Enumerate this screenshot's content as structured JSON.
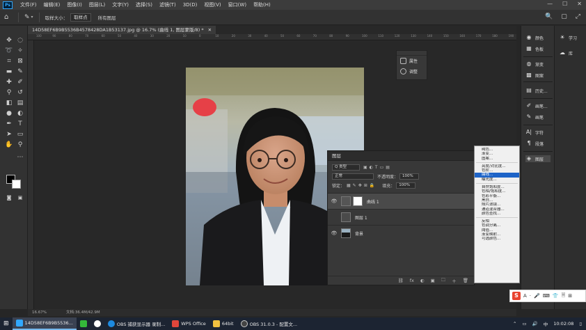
{
  "menubar": {
    "logo": "Ps",
    "items": [
      "文件(F)",
      "编辑(E)",
      "图像(I)",
      "图层(L)",
      "文字(Y)",
      "选择(S)",
      "滤镜(T)",
      "3D(D)",
      "视图(V)",
      "窗口(W)",
      "帮助(H)"
    ],
    "controls": [
      "—",
      "☐",
      "✕"
    ]
  },
  "optionsbar": {
    "sample_label": "取样大小：",
    "sample_value": "取样点",
    "sample2": "所有图层",
    "right_icons": [
      "🔍",
      "▢",
      "⤢"
    ]
  },
  "document": {
    "tab_title": "14D58EF6B9B5536B4578428DA1B53137.jpg @ 16.7% (曲线 1, 图层蒙版/8) *",
    "tab_close": "✕"
  },
  "ruler": {
    "ticks": [
      "100",
      "90",
      "80",
      "70",
      "60",
      "50",
      "40",
      "30",
      "20",
      "10",
      "0",
      "10",
      "20",
      "30",
      "40",
      "50",
      "60",
      "70",
      "80",
      "90",
      "100",
      "110",
      "120",
      "130",
      "140",
      "150",
      "160",
      "170",
      "180",
      "190"
    ]
  },
  "status": {
    "zoom": "16.67%",
    "doc": "文档:36.4M/42.9M"
  },
  "float_panel": {
    "items": [
      "属性",
      "调整"
    ]
  },
  "right_dock1": {
    "items": [
      {
        "label": "颜色",
        "icon": "palette-icon"
      },
      {
        "label": "色板",
        "icon": "swatches-icon"
      },
      {
        "label": "渐变",
        "icon": "gradient-icon"
      },
      {
        "label": "图案",
        "icon": "pattern-icon"
      },
      {
        "label": "历史...",
        "icon": "history-icon"
      },
      {
        "label": "画笔...",
        "icon": "brush-icon"
      },
      {
        "label": "画笔",
        "icon": "brush2-icon"
      },
      {
        "label": "字符",
        "icon": "char-icon"
      },
      {
        "label": "段落",
        "icon": "paragraph-icon"
      },
      {
        "label": "图层",
        "icon": "layers-icon"
      }
    ]
  },
  "right_dock2": {
    "items": [
      {
        "label": "学习",
        "icon": "bulb-icon"
      },
      {
        "label": "库",
        "icon": "library-icon"
      }
    ]
  },
  "layers": {
    "tab": "图层",
    "filter_kind": "Q 类型",
    "blend_mode": "正常",
    "opacity_label": "不透明度：",
    "opacity_value": "100%",
    "lock_label": "锁定：",
    "fill_label": "填充：",
    "fill_value": "100%",
    "items": [
      {
        "name": "曲线 1",
        "active": true,
        "visible": true
      },
      {
        "name": "图层 1",
        "active": false,
        "visible": false
      },
      {
        "name": "背景",
        "active": false,
        "visible": true
      }
    ],
    "footer_icons": [
      "⛓",
      "fx",
      "◐",
      "▣",
      "🗀",
      "＋",
      "🗑"
    ]
  },
  "context_menu": {
    "groups": [
      [
        "纯色...",
        "渐变...",
        "图案..."
      ],
      [
        "亮度/对比度...",
        "色阶...",
        "曲线...",
        "曝光度..."
      ],
      [
        "自然饱和度...",
        "色相/饱和度...",
        "色彩平衡...",
        "黑白...",
        "照片滤镜...",
        "通道混合器...",
        "颜色查找..."
      ],
      [
        "反相",
        "色调分离...",
        "阈值...",
        "渐变映射...",
        "可选颜色..."
      ]
    ],
    "highlighted": "曲线..."
  },
  "ime": {
    "logo": "S",
    "items": [
      "A",
      "·",
      "🎤",
      "⌨",
      "👕",
      "🗏",
      "⊞"
    ]
  },
  "taskbar": {
    "items": [
      {
        "label": "14D58EF6B9B5536...",
        "color": "#31a8ff",
        "active": true
      },
      {
        "label": "",
        "color": "#35b83a",
        "active": false
      },
      {
        "label": "",
        "color": "#ffffff",
        "active": false
      },
      {
        "label": "OBS 捕获显示器 录制...",
        "color": "#1d8ae0",
        "active": false
      },
      {
        "label": "WPS Office",
        "color": "#e0463b",
        "active": false
      },
      {
        "label": "64bit",
        "color": "#f0c040",
        "active": false
      },
      {
        "label": "OBS 31.0.3 - 配置文...",
        "color": "#444444",
        "active": false
      }
    ],
    "time": "10:02:08"
  },
  "colors": {
    "accent": "#31a8ff",
    "highlight": "#1e64c8"
  }
}
